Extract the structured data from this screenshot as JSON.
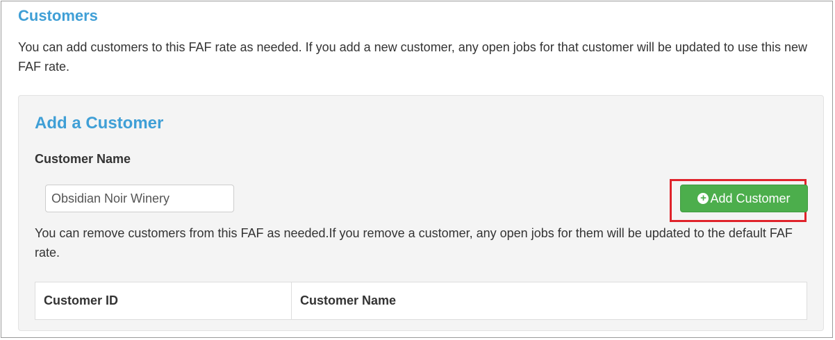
{
  "customers_section": {
    "title": "Customers",
    "intro": "You can add customers to this FAF rate as needed. If you add a new customer, any open jobs for that customer will be updated to use this new FAF rate."
  },
  "add_customer": {
    "title": "Add a Customer",
    "field_label": "Customer Name",
    "input_value": "Obsidian Noir Winery",
    "button_label": "Add Customer",
    "button_icon": "plus-circle-icon",
    "remove_info": "You can remove customers from this FAF as needed.If you remove a customer, any open jobs for them will be updated to the default FAF rate."
  },
  "table": {
    "columns": [
      "Customer ID",
      "Customer Name"
    ]
  },
  "colors": {
    "heading": "#3f9fd6",
    "button": "#4cae4c",
    "highlight": "#e0232b",
    "well_background": "#f4f4f4"
  }
}
